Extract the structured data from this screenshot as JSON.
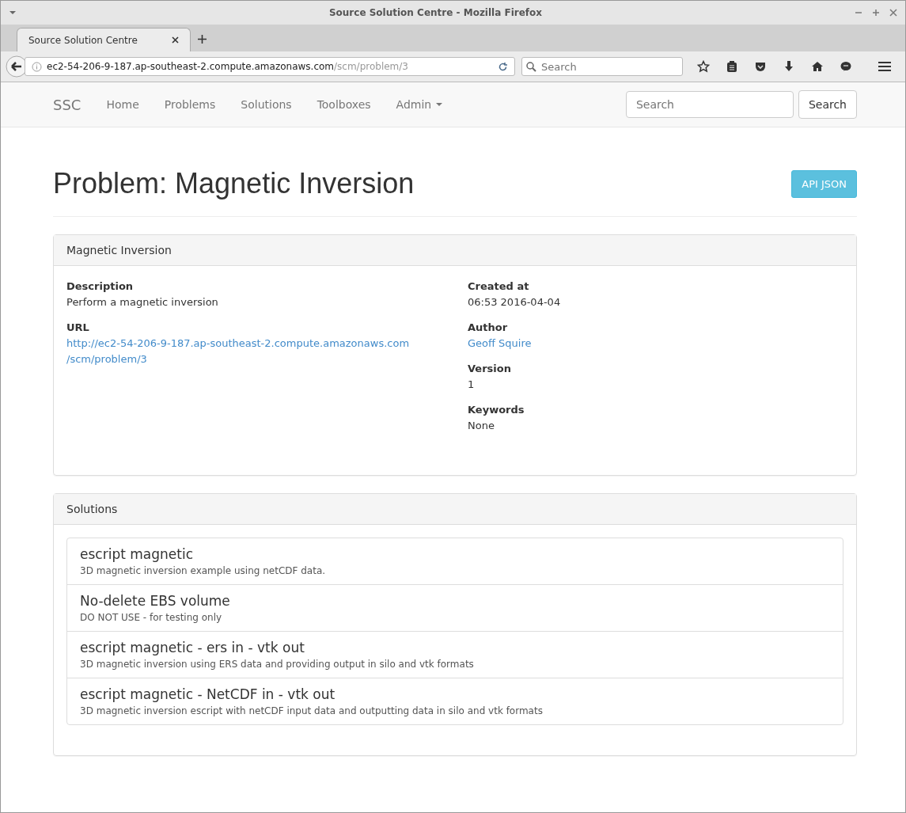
{
  "window": {
    "title": "Source Solution Centre - Mozilla Firefox"
  },
  "tabs": [
    {
      "label": "Source Solution Centre",
      "selected": true
    }
  ],
  "address_bar": {
    "host": "ec2-54-206-9-187.ap-southeast-2.compute.amazonaws.com",
    "path": "/scm/problem/3"
  },
  "browser_search": {
    "placeholder": "Search"
  },
  "navbar": {
    "brand": "SSC",
    "items": [
      {
        "label": "Home",
        "kind": "link"
      },
      {
        "label": "Problems",
        "kind": "link"
      },
      {
        "label": "Solutions",
        "kind": "link"
      },
      {
        "label": "Toolboxes",
        "kind": "link"
      },
      {
        "label": "Admin",
        "kind": "dropdown"
      }
    ],
    "search": {
      "placeholder": "Search",
      "button": "Search"
    }
  },
  "page": {
    "title": "Problem: Magnetic Inversion",
    "api_button": "API JSON"
  },
  "details": {
    "heading": "Magnetic Inversion",
    "left": [
      {
        "label": "Description",
        "kind": "text",
        "lines": [
          "Perform a magnetic inversion"
        ]
      },
      {
        "label": "URL",
        "kind": "link",
        "lines": [
          "http://ec2-54-206-9-187.ap-southeast-2.compute.amazonaws.com",
          "/scm/problem/3"
        ]
      }
    ],
    "right": [
      {
        "label": "Created at",
        "kind": "text",
        "lines": [
          "06:53 2016-04-04"
        ]
      },
      {
        "label": "Author",
        "kind": "link",
        "lines": [
          "Geoff Squire"
        ]
      },
      {
        "label": "Version",
        "kind": "text",
        "lines": [
          "1"
        ]
      },
      {
        "label": "Keywords",
        "kind": "text",
        "lines": [
          "None"
        ]
      }
    ]
  },
  "solutions": {
    "heading": "Solutions",
    "items": [
      {
        "name": "escript magnetic",
        "description": "3D magnetic inversion example using netCDF data."
      },
      {
        "name": "No-delete EBS volume",
        "description": "DO NOT USE - for testing only"
      },
      {
        "name": "escript magnetic - ers in - vtk out",
        "description": "3D magnetic inversion using ERS data and providing output in silo and vtk formats"
      },
      {
        "name": "escript magnetic - NetCDF in - vtk out",
        "description": "3D magnetic inversion escript with netCDF input data and outputting data in silo and vtk formats"
      }
    ]
  }
}
